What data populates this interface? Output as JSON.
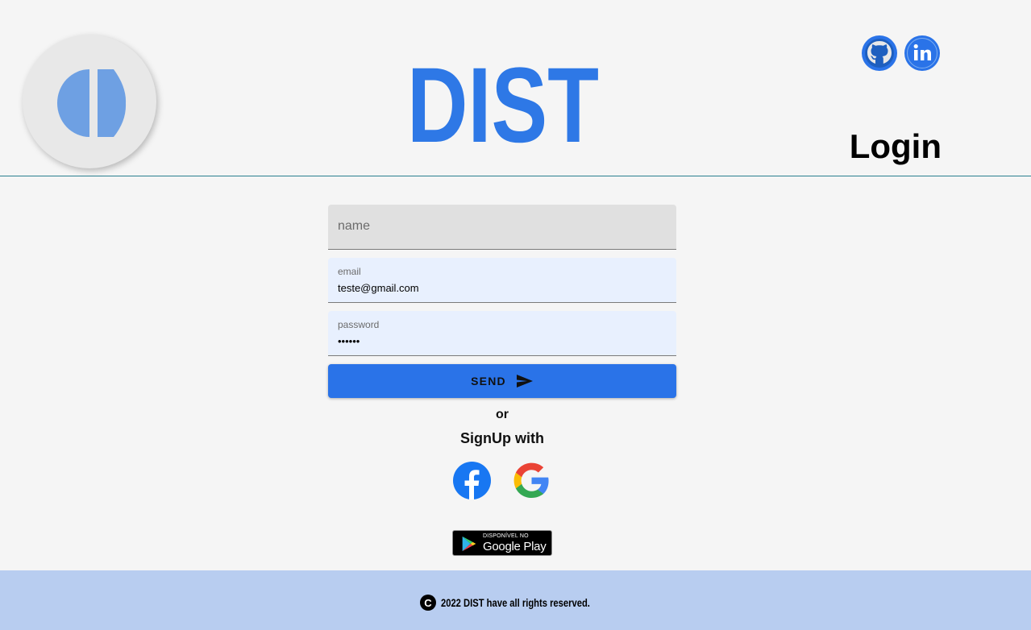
{
  "header": {
    "brand": "DIST",
    "page_title": "Login",
    "social": [
      {
        "icon": "github-icon"
      },
      {
        "icon": "linkedin-icon"
      }
    ]
  },
  "form": {
    "name": {
      "placeholder": "name",
      "value": ""
    },
    "email": {
      "label": "email",
      "value": "teste@gmail.com"
    },
    "password": {
      "label": "password",
      "value": "••••••"
    },
    "send_label": "SEND"
  },
  "alt": {
    "or": "or",
    "signup": "SignUp with",
    "providers": [
      "facebook-icon",
      "google-icon"
    ]
  },
  "store_badge": {
    "small": "DISPONÍVEL NO",
    "big": "Google Play"
  },
  "footer": {
    "copyright_icon": "C",
    "text": "2022 DIST have all rights reserved."
  },
  "colors": {
    "primary": "#2a73e8",
    "footer_bg": "#b8cdf0",
    "background": "#f5f5f5"
  }
}
